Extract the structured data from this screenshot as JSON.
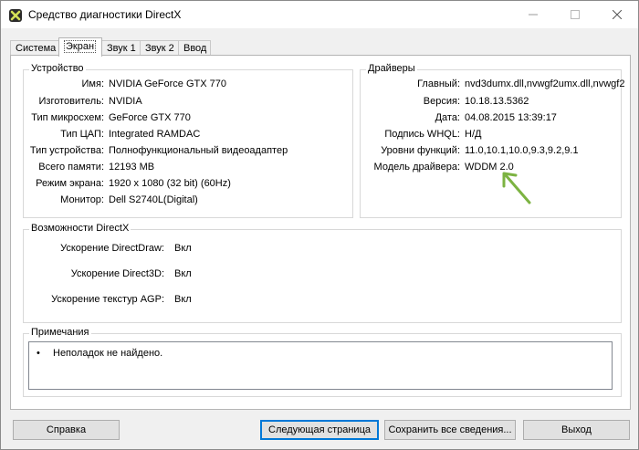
{
  "window": {
    "title": "Средство диагностики DirectX"
  },
  "tabs": [
    {
      "label": "Система"
    },
    {
      "label": "Экран"
    },
    {
      "label": "Звук 1"
    },
    {
      "label": "Звук 2"
    },
    {
      "label": "Ввод"
    }
  ],
  "device": {
    "title": "Устройство",
    "rows": [
      {
        "label": "Имя:",
        "value": "NVIDIA GeForce GTX 770"
      },
      {
        "label": "Изготовитель:",
        "value": "NVIDIA"
      },
      {
        "label": "Тип микросхем:",
        "value": "GeForce GTX 770"
      },
      {
        "label": "Тип ЦАП:",
        "value": "Integrated RAMDAC"
      },
      {
        "label": "Тип устройства:",
        "value": "Полнофункциональный видеоадаптер"
      },
      {
        "label": "Всего памяти:",
        "value": "12193 MB"
      },
      {
        "label": "Режим экрана:",
        "value": "1920 x 1080 (32 bit) (60Hz)"
      },
      {
        "label": "Монитор:",
        "value": "Dell S2740L(Digital)"
      }
    ]
  },
  "drivers": {
    "title": "Драйверы",
    "rows": [
      {
        "label": "Главный:",
        "value": "nvd3dumx.dll,nvwgf2umx.dll,nvwgf2"
      },
      {
        "label": "Версия:",
        "value": "10.18.13.5362"
      },
      {
        "label": "Дата:",
        "value": "04.08.2015 13:39:17"
      },
      {
        "label": "Подпись WHQL:",
        "value": "Н/Д"
      },
      {
        "label": "Уровни функций:",
        "value": "11.0,10.1,10.0,9.3,9.2,9.1"
      },
      {
        "label": "Модель драйвера:",
        "value": "WDDM 2.0"
      }
    ]
  },
  "directx": {
    "title": "Возможности DirectX",
    "rows": [
      {
        "label": "Ускорение DirectDraw:",
        "value": "Вкл"
      },
      {
        "label": "Ускорение Direct3D:",
        "value": "Вкл"
      },
      {
        "label": "Ускорение текстур AGP:",
        "value": "Вкл"
      }
    ]
  },
  "notes": {
    "title": "Примечания",
    "bullet": "•",
    "text": "Неполадок не найдено."
  },
  "buttons": {
    "help": "Справка",
    "next": "Следующая страница",
    "save": "Сохранить все сведения...",
    "exit": "Выход"
  },
  "colors": {
    "arrow": "#7cb342"
  },
  "icons": {
    "app": "directx-icon",
    "minimize": "minimize-icon",
    "maximize": "maximize-icon",
    "close": "close-icon",
    "arrow": "green-arrow-annotation"
  }
}
